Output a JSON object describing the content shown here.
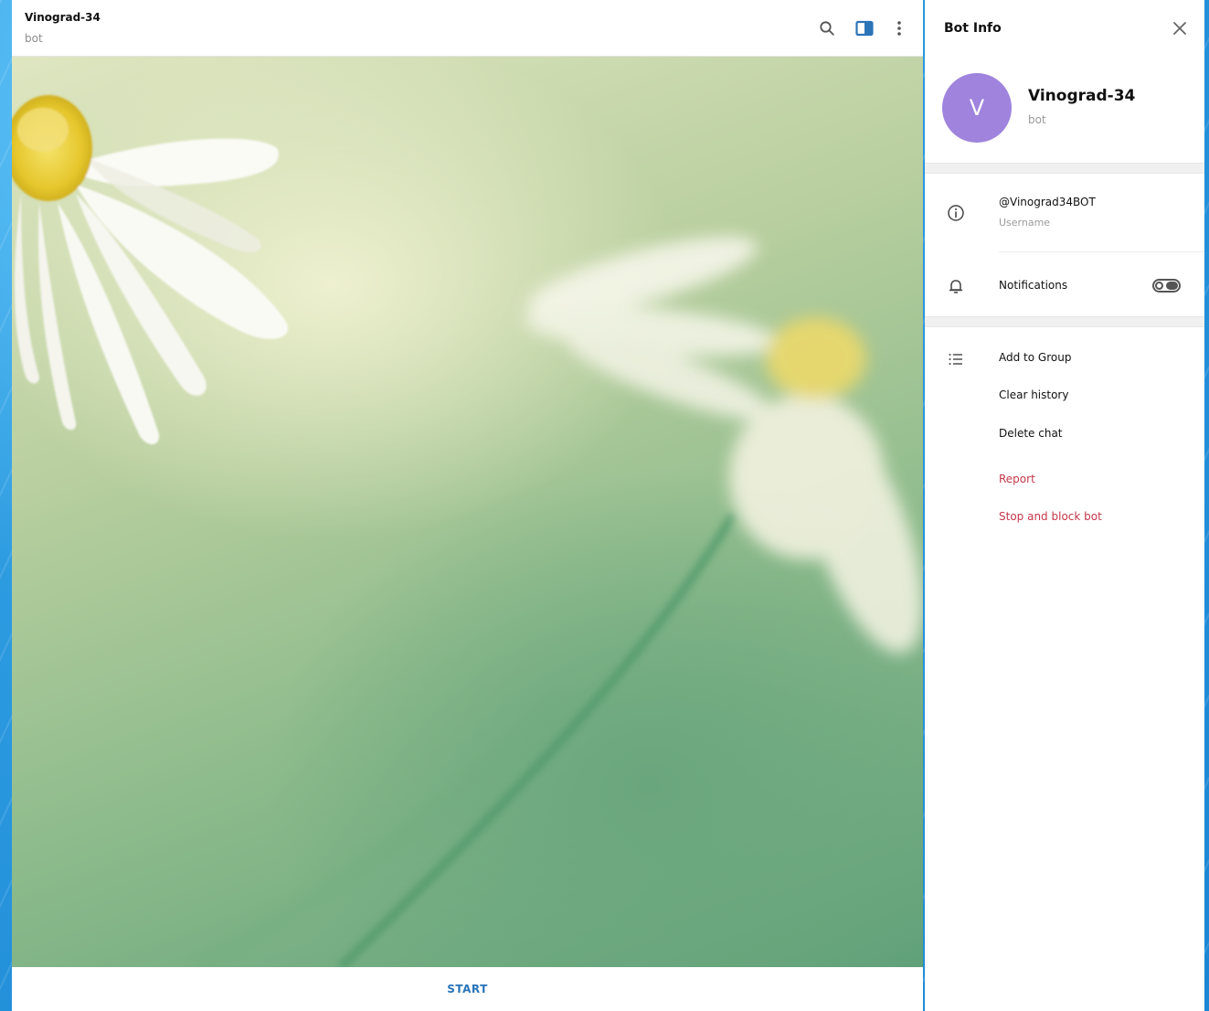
{
  "chat": {
    "title": "Vinograd-34",
    "subtitle": "bot",
    "header_icons": [
      "search-icon",
      "sidebar-toggle-icon",
      "more-vertical-icon"
    ],
    "start_label": "START"
  },
  "bot_info": {
    "title": "Bot Info",
    "avatar_letter": "V",
    "avatar_color": "#9f83dd",
    "name": "Vinograd-34",
    "status": "bot",
    "username": "@Vinograd34BOT",
    "username_caption": "Username",
    "notifications_label": "Notifications",
    "notifications_enabled": false,
    "actions": [
      {
        "label": "Add to Group",
        "danger": false
      },
      {
        "label": "Clear history",
        "danger": false
      },
      {
        "label": "Delete chat",
        "danger": false
      },
      {
        "label": "Report",
        "danger": true
      },
      {
        "label": "Stop and block bot",
        "danger": true
      }
    ]
  },
  "colors": {
    "accent": "#2b74b8",
    "danger": "#c4384a"
  }
}
